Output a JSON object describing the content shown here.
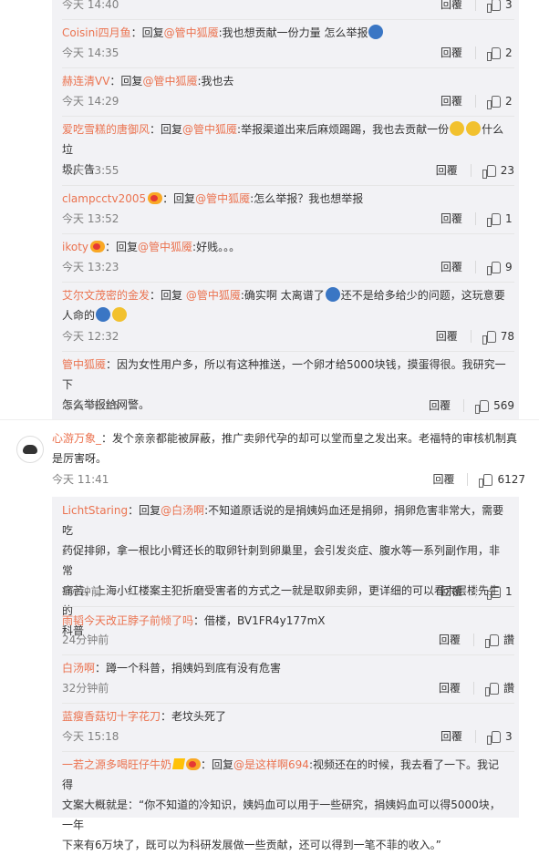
{
  "reply_label": "回覆",
  "comments": [
    {
      "time": "今天 14:40",
      "likes": "3"
    },
    {
      "user": "Coisini四月鱼",
      "prefix": "：回复",
      "at": "@管中狐魇",
      "text": ":我也想贡献一份力量 怎么举报",
      "time": "今天 14:35",
      "likes": "2",
      "emoji": "blue"
    },
    {
      "user": "赫连清VV",
      "prefix": "：回复",
      "at": "@管中狐魇",
      "text": ":我也去",
      "time": "今天 14:29",
      "likes": "2"
    },
    {
      "user": "爱吃雪糕的唐御风",
      "prefix": "：回复",
      "at": "@管中狐魇",
      "text": ":举报渠道出来后麻烦踢踢，我也去贡献一份",
      "text2": "什么垃",
      "line2": "圾广告",
      "time": "今天 13:55",
      "likes": "23"
    },
    {
      "user": "clampcctv2005",
      "prefix": "：回复",
      "at": "@管中狐魇",
      "text": ":怎么举报？我也想举报",
      "time": "今天 13:52",
      "likes": "1"
    },
    {
      "user": "ikoty",
      "prefix": "：回复",
      "at": "@管中狐魇",
      "text": ":好贱。。。",
      "time": "今天 13:23",
      "likes": "9"
    },
    {
      "user": "艾尔文茂密的金发",
      "prefix": "：回复 ",
      "at": "@管中狐魇",
      "text": ":确实啊 太离谱了",
      "text2": "还不是给多给少的问题，这玩意要",
      "line2": "人命的",
      "time": "今天 12:32",
      "likes": "78"
    },
    {
      "user": "管中狐魇",
      "prefix": "：",
      "text": "因为女性用户多，所以有这种推送，一个卵才给5000块钱，摸蛋得很。我研究一下",
      "line2": "怎么举报给网警。",
      "time": "今天 00:25",
      "likes": "569"
    }
  ],
  "main_comment": {
    "user": "心游万象_",
    "text": "：发个亲亲都能被屏蔽，推广卖卵代孕的却可以堂而皇之发出来。老福特的审核机制真",
    "line2": "是厉害呀。",
    "time": "今天 11:41",
    "likes": "6127"
  },
  "replies": [
    {
      "user": "LichtStaring",
      "prefix": "：回复",
      "at": "@白汤啊",
      "text": ":不知道原话说的是捐姨妈血还是捐卵，捐卵危害非常大，需要吃",
      "lines": [
        "药促排卵，拿一根比小臂还长的取卵针刺到卵巢里，会引发炎症、腹水等一系列副作用，非常",
        "痛苦，上海小红楼案主犯折磨受害者的方式之一就是取卵卖卵，更详细的可以看六层楼先生的",
        "科普"
      ],
      "time": "1分钟前",
      "likes": "1"
    },
    {
      "user": "雨韬今天改正脖子前倾了吗",
      "prefix": "：",
      "text": "借楼，BV1FR4y177mX",
      "time": "24分钟前",
      "likes": "讚"
    },
    {
      "user": "白汤啊",
      "prefix": "：",
      "text": "蹲一个科普，捐姨妈到底有没有危害",
      "time": "32分钟前",
      "likes": "讚"
    },
    {
      "user": "蓝瘦香菇切十字花刀",
      "prefix": "：",
      "text": "老坟头死了",
      "time": "今天 15:18",
      "likes": "3"
    },
    {
      "user": "一若之源多喝旺仔牛奶",
      "prefix": "：回复",
      "at": "@是这样啊694",
      "text": ":视频还在的时候，我去看了一下。我记得",
      "lines": [
        "文案大概就是：“你不知道的冷知识，姨妈血可以用于一些研究，捐姨妈血可以得5000块，一年",
        "下来有6万块了，既可以为科研发展做一些贡献，还可以得到一笔不菲的收入。”"
      ]
    }
  ]
}
